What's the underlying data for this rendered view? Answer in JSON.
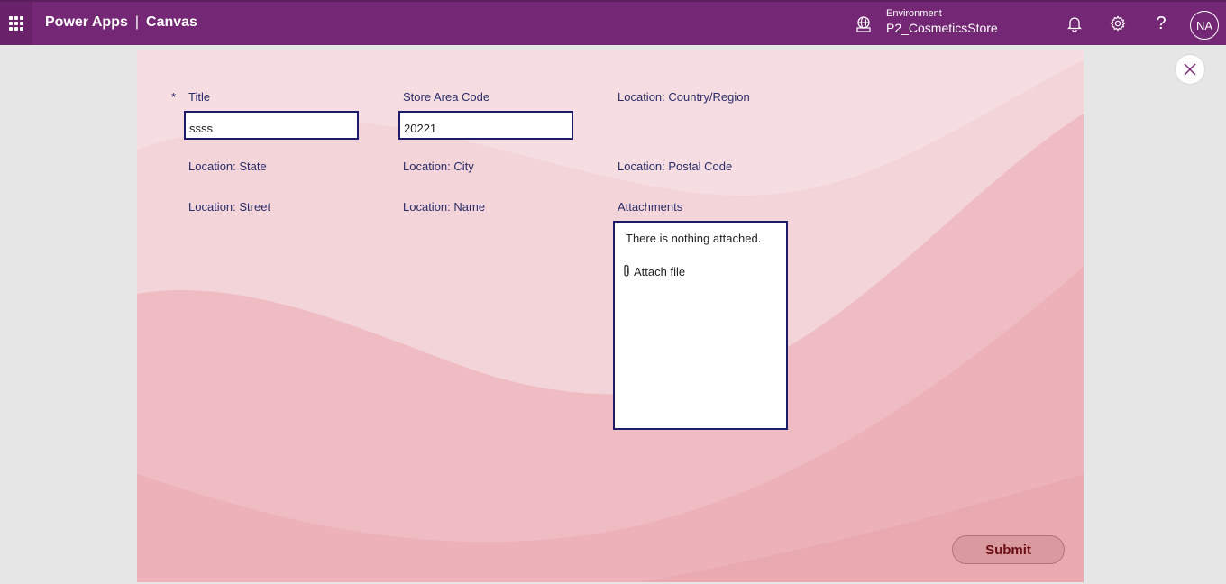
{
  "header": {
    "app_name": "Power Apps",
    "separator": "|",
    "app_type": "Canvas",
    "environment_label": "Environment",
    "environment_name": "P2_CosmeticsStore",
    "help_glyph": "?",
    "avatar_initials": "NA",
    "bar_color": "#742774"
  },
  "form": {
    "required_marker": "*",
    "title_label": "Title",
    "title_value": "ssss",
    "store_area_code_label": "Store Area Code",
    "store_area_code_value": "20221",
    "country_label": "Location: Country/Region",
    "state_label": "Location: State",
    "city_label": "Location: City",
    "postal_label": "Location: Postal Code",
    "street_label": "Location: Street",
    "name_label": "Location: Name",
    "attachments_label": "Attachments",
    "attachments_empty": "There is nothing attached.",
    "attach_file": "Attach file",
    "submit_label": "Submit"
  },
  "icons": [
    "waffle-icon",
    "environment-icon",
    "bell-icon",
    "gear-icon",
    "help-icon",
    "close-icon",
    "paperclip-icon"
  ]
}
